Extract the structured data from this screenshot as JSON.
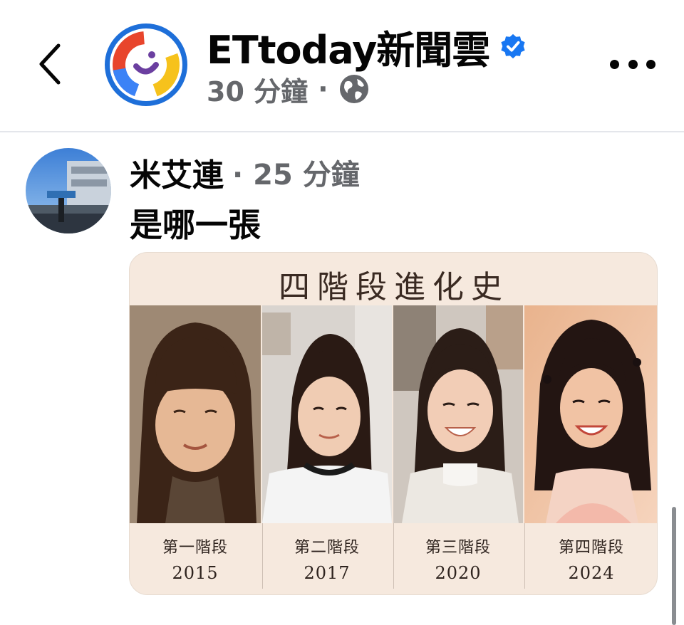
{
  "header": {
    "page_name": "ETtoday新聞雲",
    "time": "30 分鐘",
    "dot": "·",
    "audience_icon": "globe-icon",
    "verified_icon": "verified-badge-icon",
    "back_icon": "chevron-left-icon",
    "more_icon": "more-horizontal-icon"
  },
  "comment": {
    "author": "米艾連",
    "time": "· 25 分鐘",
    "text": "是哪一張"
  },
  "attachment": {
    "title": "四階段進化史",
    "stages": [
      {
        "label": "第一階段",
        "year": "2015"
      },
      {
        "label": "第二階段",
        "year": "2017"
      },
      {
        "label": "第三階段",
        "year": "2020"
      },
      {
        "label": "第四階段",
        "year": "2024"
      }
    ]
  },
  "colors": {
    "verified": "#1877f2",
    "secondary_text": "#65676b",
    "card_bg": "#f6e9de",
    "logo_ring_blue": "#1e6fd9",
    "logo_red": "#e8452c",
    "logo_yellow": "#f6c21c",
    "logo_purple": "#6b3fa0"
  }
}
